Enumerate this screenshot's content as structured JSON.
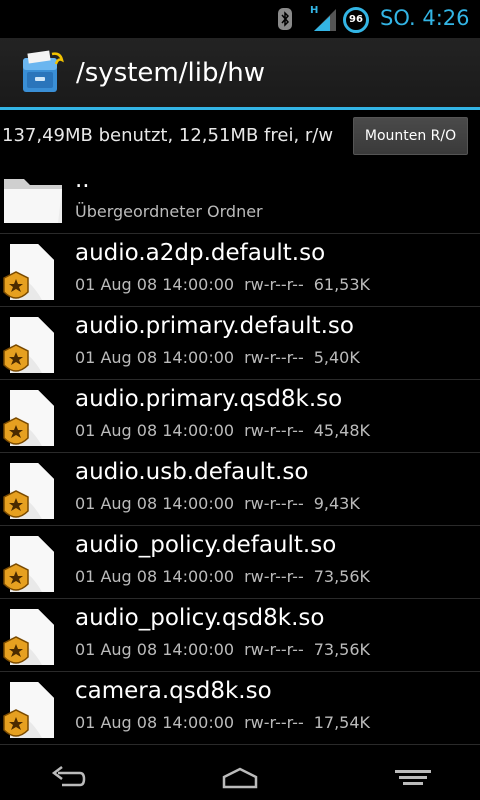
{
  "status_bar": {
    "time": "SO. 4:26",
    "battery_level": "96",
    "network_type": "H",
    "icons": [
      "bluetooth-icon",
      "signal-icon",
      "battery-icon"
    ],
    "accent_color": "#33b5e5"
  },
  "action_bar": {
    "title": "/system/lib/hw",
    "icon": "file-manager-icon"
  },
  "storage": {
    "info": "137,49MB benutzt, 12,51MB frei, r/w",
    "mount_button": "Mounten R/O"
  },
  "parent": {
    "name": "..",
    "subtitle": "Übergeordneter Ordner",
    "icon": "folder-icon"
  },
  "files": [
    {
      "name": "audio.a2dp.default.so",
      "date": "01 Aug 08 14:00:00",
      "perm": "rw-r--r--",
      "size": "61,53K"
    },
    {
      "name": "audio.primary.default.so",
      "date": "01 Aug 08 14:00:00",
      "perm": "rw-r--r--",
      "size": "5,40K"
    },
    {
      "name": "audio.primary.qsd8k.so",
      "date": "01 Aug 08 14:00:00",
      "perm": "rw-r--r--",
      "size": "45,48K"
    },
    {
      "name": "audio.usb.default.so",
      "date": "01 Aug 08 14:00:00",
      "perm": "rw-r--r--",
      "size": "9,43K"
    },
    {
      "name": "audio_policy.default.so",
      "date": "01 Aug 08 14:00:00",
      "perm": "rw-r--r--",
      "size": "73,56K"
    },
    {
      "name": "audio_policy.qsd8k.so",
      "date": "01 Aug 08 14:00:00",
      "perm": "rw-r--r--",
      "size": "73,56K"
    },
    {
      "name": "camera.qsd8k.so",
      "date": "01 Aug 08 14:00:00",
      "perm": "rw-r--r--",
      "size": "17,54K"
    }
  ],
  "navigation": {
    "icons": [
      "back-icon",
      "home-icon",
      "menu-icon"
    ]
  }
}
